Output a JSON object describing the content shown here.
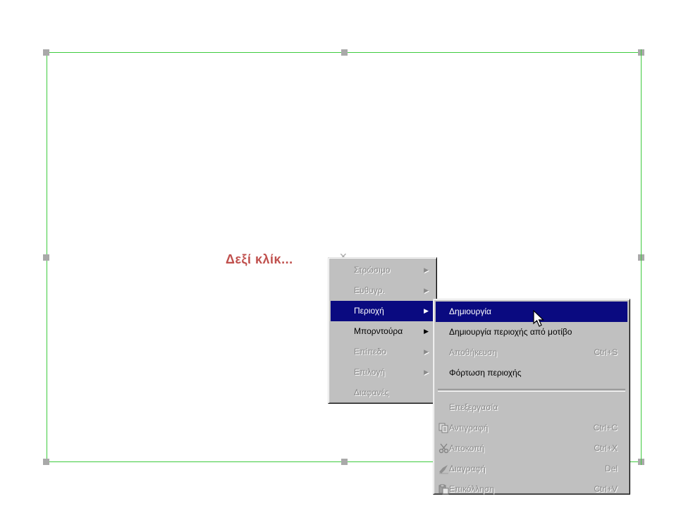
{
  "hint": {
    "text": "Δεξί κλίκ..."
  },
  "main_menu": {
    "items": [
      {
        "label": "Στρώσιμο",
        "disabled": true,
        "submenu": true
      },
      {
        "label": "Ευθυγρ.",
        "disabled": true,
        "submenu": true
      },
      {
        "label": "Περιοχή",
        "disabled": false,
        "submenu": true,
        "active": true
      },
      {
        "label": "Μπορντούρα",
        "disabled": false,
        "submenu": true
      },
      {
        "label": "Επίπεδο",
        "disabled": true,
        "submenu": true
      },
      {
        "label": "Επιλογή",
        "disabled": true,
        "submenu": true
      },
      {
        "label": "Διαφανές",
        "disabled": true,
        "submenu": false
      }
    ]
  },
  "sub_menu": {
    "items": [
      {
        "label": "Δημιουργία",
        "shortcut": ""
      },
      {
        "label": "Δημιουργία περιοχής από μοτίβο",
        "shortcut": ""
      },
      {
        "label": "Αποθήκευση",
        "shortcut": "Ctrl+S"
      },
      {
        "label": "Φόρτωση περιοχής",
        "shortcut": ""
      },
      {
        "label": "Επεξεργασία",
        "shortcut": ""
      },
      {
        "label": "Αντιγραφή",
        "shortcut": "Ctrl+C",
        "icon": "copy-icon"
      },
      {
        "label": "Αποκοπή",
        "shortcut": "Ctrl+X",
        "icon": "scissors-icon"
      },
      {
        "label": "Διαγραφή",
        "shortcut": "Del",
        "icon": "eraser-icon"
      },
      {
        "label": "Επικόλληση",
        "shortcut": "Ctrl+V",
        "icon": "paste-icon"
      }
    ]
  },
  "colors": {
    "hint": "#c0504d",
    "selection_frame": "#3ecb3e",
    "menu_bg": "#c0c0c0",
    "highlight": "#0a0a80"
  }
}
